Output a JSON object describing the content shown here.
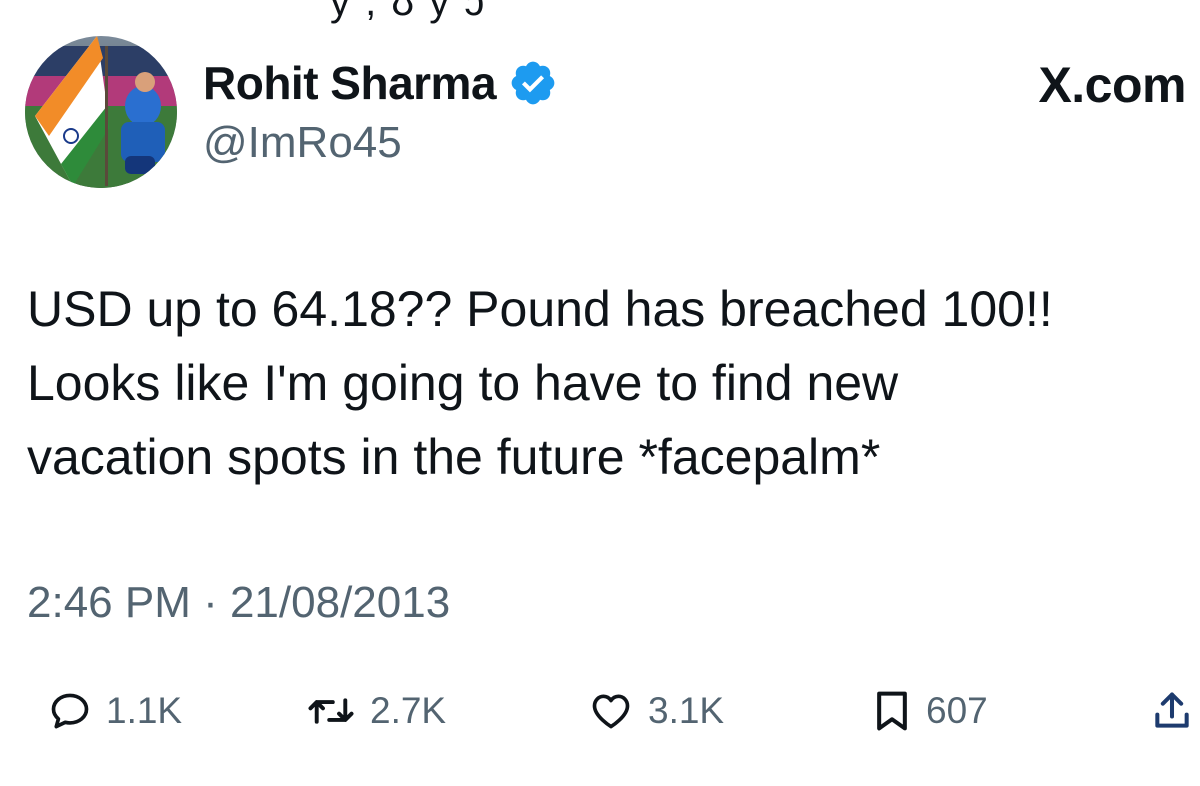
{
  "header": {
    "display_name": "Rohit Sharma",
    "handle": "@ImRo45",
    "brand": "X.com",
    "verified": true
  },
  "tweet": {
    "lines": [
      "USD up to 64.18?? Pound has breached 100!!",
      "Looks like I'm going to have to find new",
      "vacation spots in the future *facepalm*"
    ],
    "timestamp": "2:46 PM · 21/08/2013"
  },
  "actions": {
    "replies": "1.1K",
    "reposts": "2.7K",
    "likes": "3.1K",
    "bookmarks": "607"
  },
  "icons": {
    "reply": "reply-icon",
    "repost": "repost-icon",
    "like": "heart-icon",
    "bookmark": "bookmark-icon",
    "share": "share-icon",
    "verified": "verified-badge-icon"
  },
  "colors": {
    "text": "#0f1419",
    "secondary": "#536471",
    "verified": "#1d9bf0"
  }
}
